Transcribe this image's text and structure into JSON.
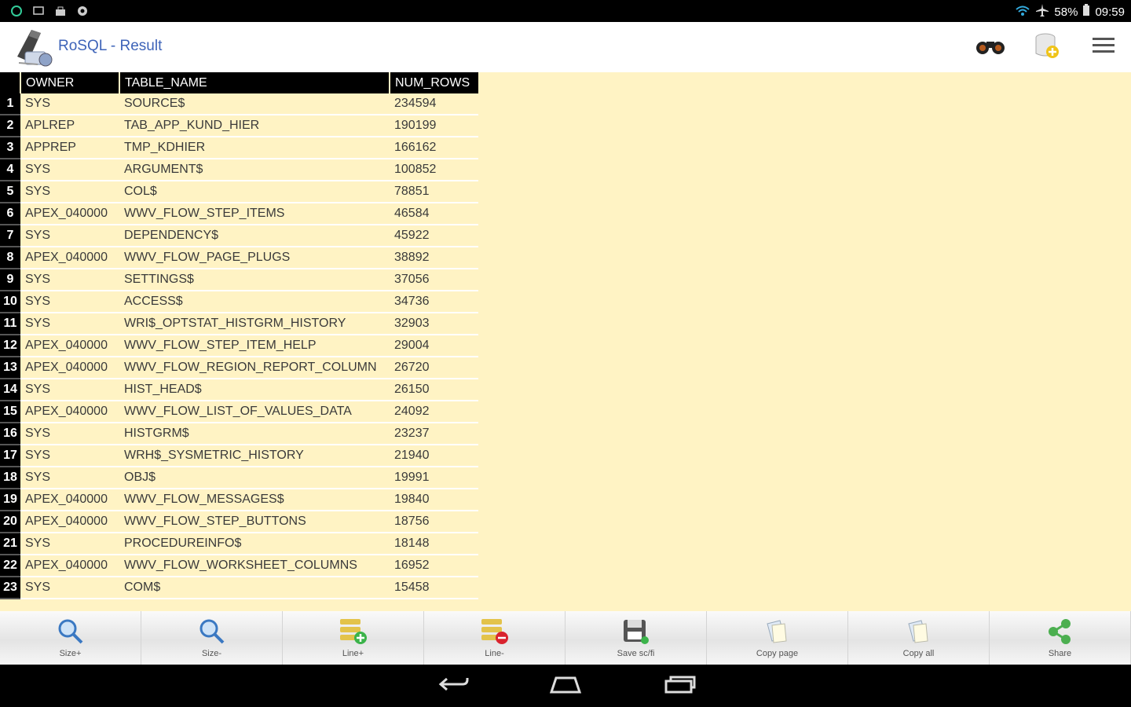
{
  "status_bar": {
    "battery": "58%",
    "time": "09:59"
  },
  "header": {
    "title": "RoSQL - Result"
  },
  "table": {
    "columns": [
      "OWNER",
      "TABLE_NAME",
      "NUM_ROWS"
    ],
    "rows": [
      {
        "n": "1",
        "owner": "SYS",
        "table": "SOURCE$",
        "num": "234594"
      },
      {
        "n": "2",
        "owner": "APLREP",
        "table": "TAB_APP_KUND_HIER",
        "num": "190199"
      },
      {
        "n": "3",
        "owner": "APPREP",
        "table": "TMP_KDHIER",
        "num": "166162"
      },
      {
        "n": "4",
        "owner": "SYS",
        "table": "ARGUMENT$",
        "num": "100852"
      },
      {
        "n": "5",
        "owner": "SYS",
        "table": "COL$",
        "num": "78851"
      },
      {
        "n": "6",
        "owner": "APEX_040000",
        "table": "WWV_FLOW_STEP_ITEMS",
        "num": "46584"
      },
      {
        "n": "7",
        "owner": "SYS",
        "table": "DEPENDENCY$",
        "num": "45922"
      },
      {
        "n": "8",
        "owner": "APEX_040000",
        "table": "WWV_FLOW_PAGE_PLUGS",
        "num": "38892"
      },
      {
        "n": "9",
        "owner": "SYS",
        "table": "SETTINGS$",
        "num": "37056"
      },
      {
        "n": "10",
        "owner": "SYS",
        "table": "ACCESS$",
        "num": "34736"
      },
      {
        "n": "11",
        "owner": "SYS",
        "table": "WRI$_OPTSTAT_HISTGRM_HISTORY",
        "num": "32903"
      },
      {
        "n": "12",
        "owner": "APEX_040000",
        "table": "WWV_FLOW_STEP_ITEM_HELP",
        "num": "29004"
      },
      {
        "n": "13",
        "owner": "APEX_040000",
        "table": "WWV_FLOW_REGION_REPORT_COLUMN",
        "num": "26720"
      },
      {
        "n": "14",
        "owner": "SYS",
        "table": "HIST_HEAD$",
        "num": "26150"
      },
      {
        "n": "15",
        "owner": "APEX_040000",
        "table": "WWV_FLOW_LIST_OF_VALUES_DATA",
        "num": "24092"
      },
      {
        "n": "16",
        "owner": "SYS",
        "table": "HISTGRM$",
        "num": "23237"
      },
      {
        "n": "17",
        "owner": "SYS",
        "table": "WRH$_SYSMETRIC_HISTORY",
        "num": "21940"
      },
      {
        "n": "18",
        "owner": "SYS",
        "table": "OBJ$",
        "num": "19991"
      },
      {
        "n": "19",
        "owner": "APEX_040000",
        "table": "WWV_FLOW_MESSAGES$",
        "num": "19840"
      },
      {
        "n": "20",
        "owner": "APEX_040000",
        "table": "WWV_FLOW_STEP_BUTTONS",
        "num": "18756"
      },
      {
        "n": "21",
        "owner": "SYS",
        "table": "PROCEDUREINFO$",
        "num": "18148"
      },
      {
        "n": "22",
        "owner": "APEX_040000",
        "table": "WWV_FLOW_WORKSHEET_COLUMNS",
        "num": "16952"
      },
      {
        "n": "23",
        "owner": "SYS",
        "table": "COM$",
        "num": "15458"
      }
    ]
  },
  "bottom_bar": [
    {
      "label": "Size+",
      "icon": "zoom-in-icon"
    },
    {
      "label": "Size-",
      "icon": "zoom-out-icon"
    },
    {
      "label": "Line+",
      "icon": "add-line-icon"
    },
    {
      "label": "Line-",
      "icon": "remove-line-icon"
    },
    {
      "label": "Save sc/fi",
      "icon": "save-icon"
    },
    {
      "label": "Copy page",
      "icon": "copy-page-icon"
    },
    {
      "label": "Copy all",
      "icon": "copy-all-icon"
    },
    {
      "label": "Share",
      "icon": "share-icon"
    }
  ],
  "colors": {
    "background": "#fff3c4",
    "header_bg": "#000000",
    "title_color": "#3d63b8"
  }
}
